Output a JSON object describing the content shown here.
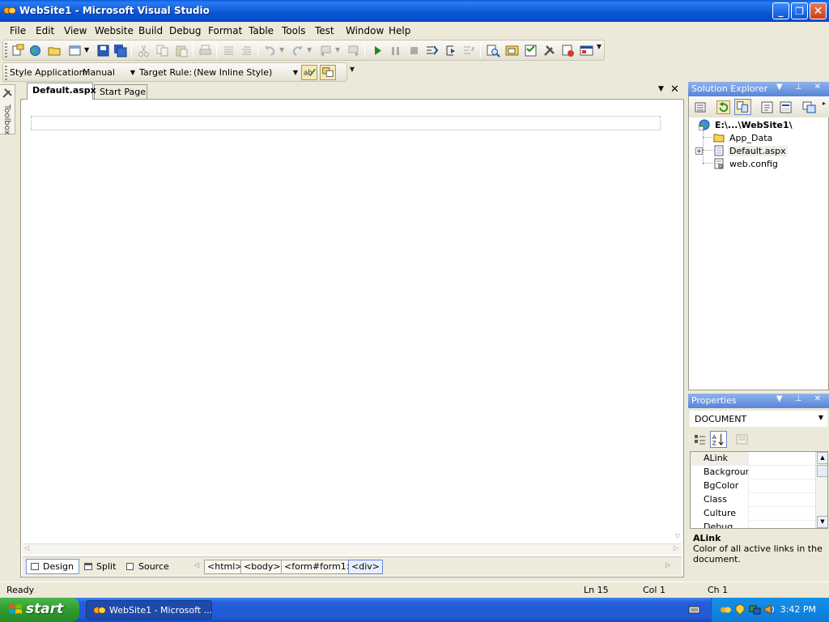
{
  "window": {
    "title": "WebSite1 - Microsoft Visual Studio",
    "minimize": "_",
    "restore": "❐",
    "close": "✕"
  },
  "menu": [
    "File",
    "Edit",
    "View",
    "Website",
    "Build",
    "Debug",
    "Format",
    "Table",
    "Tools",
    "Test",
    "Window",
    "Help"
  ],
  "style_toolbar": {
    "style_application_label": "Style Application:",
    "style_application_value": "Manual",
    "target_rule_label": "Target Rule:",
    "target_rule_value": "(New Inline Style)"
  },
  "toolbox": {
    "label": "Toolbox"
  },
  "document": {
    "tabs": [
      {
        "label": "Default.aspx",
        "active": true
      },
      {
        "label": "Start Page",
        "active": false
      }
    ],
    "view_buttons": [
      {
        "label": "Design",
        "active": true
      },
      {
        "label": "Split",
        "active": false
      },
      {
        "label": "Source",
        "active": false
      }
    ],
    "tag_breadcrumbs": [
      "<html>",
      "<body>",
      "<form#form1>",
      "<div>"
    ]
  },
  "solution_explorer": {
    "title": "Solution Explorer",
    "tree": [
      {
        "label": "E:\\...\\WebSite1\\",
        "icon": "website-globe-icon",
        "bold": true
      },
      {
        "label": "App_Data",
        "icon": "folder-icon"
      },
      {
        "label": "Default.aspx",
        "icon": "aspx-page-icon",
        "expandable": true,
        "selected": true
      },
      {
        "label": "web.config",
        "icon": "config-file-icon"
      }
    ]
  },
  "properties": {
    "title": "Properties",
    "object": "DOCUMENT",
    "rows": [
      "ALink",
      "Backgrounc",
      "BgColor",
      "Class",
      "Culture",
      "Debug"
    ],
    "selected_row": "ALink",
    "description_name": "ALink",
    "description_text": "Color of all active links in the document."
  },
  "status": {
    "message": "Ready",
    "line": "Ln 15",
    "col": "Col 1",
    "ch": "Ch 1"
  },
  "taskbar": {
    "start_label": "start",
    "task_label": "WebSite1 - Microsoft ...",
    "clock": "3:42 PM"
  },
  "colors": {
    "titlebar": "#0a58d8",
    "panel_header": "#5784d8",
    "start_button": "#2f9a2f",
    "taskbar": "#245edb"
  }
}
